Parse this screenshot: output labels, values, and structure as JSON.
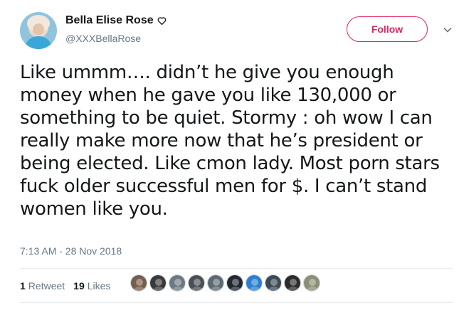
{
  "user": {
    "display_name": "Bella Elise Rose",
    "handle": "@XXXBellaRose",
    "avatar_icon": "avatar-photo"
  },
  "follow_button": {
    "label": "Follow"
  },
  "tweet": {
    "text": "Like ummm…. didn’t he give you enough money when he gave you like 130,000 or something to be quiet. Stormy : oh wow I can really make more now that he’s president or being elected. Like cmon lady. Most porn stars fuck older successful men for $. I can’t stand women like you.",
    "timestamp": "7:13 AM - 28 Nov 2018"
  },
  "stats": {
    "retweets_count": "1",
    "retweets_label": "Retweet",
    "likes_count": "19",
    "likes_label": "Likes"
  },
  "likers": [
    {
      "color": "#7a5c4a"
    },
    {
      "color": "#3a3a3a"
    },
    {
      "color": "#6b7a82"
    },
    {
      "color": "#4a4f55"
    },
    {
      "color": "#5e6a72"
    },
    {
      "color": "#222831"
    },
    {
      "color": "#2a7fd1"
    },
    {
      "color": "#3d4a55"
    },
    {
      "color": "#2b2b2b"
    },
    {
      "color": "#8a8f72"
    }
  ],
  "colors": {
    "accent": "#e0245e",
    "secondary_text": "#657786",
    "divider": "#e6ecf0"
  }
}
